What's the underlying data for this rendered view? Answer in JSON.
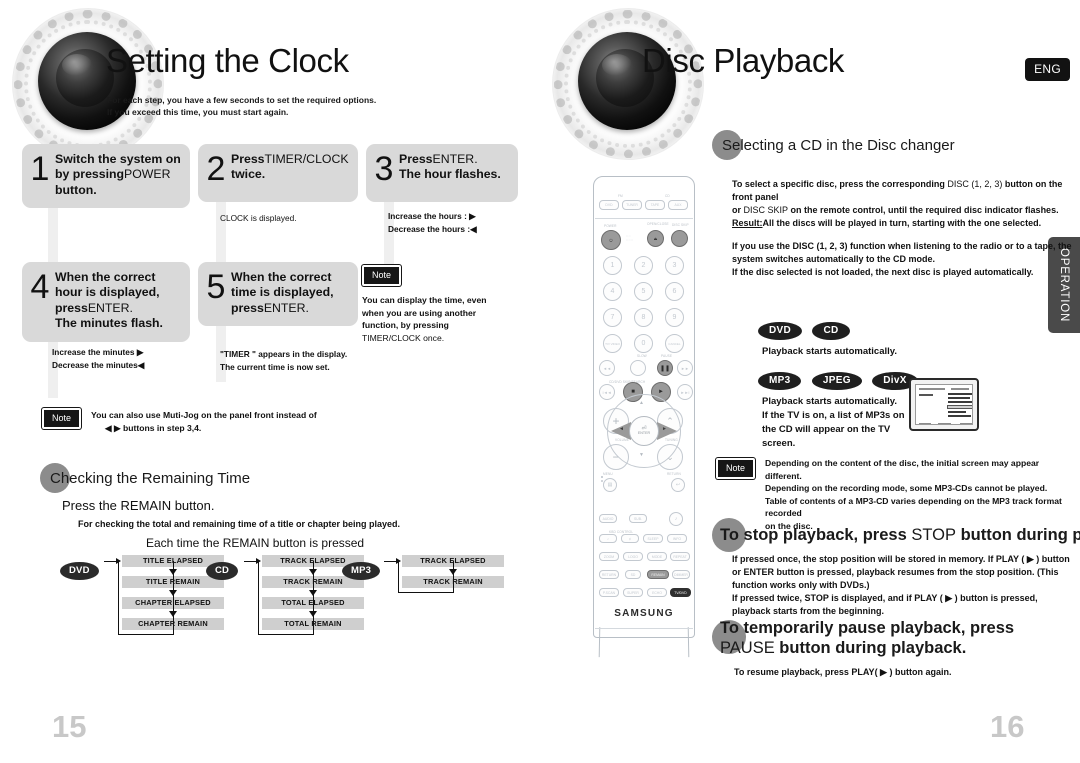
{
  "left_page": {
    "title": "Setting the Clock",
    "subtitle_lines": [
      "For each step, you have a few seconds to set the required options.",
      "If you exceed this time, you must start again."
    ],
    "steps": [
      {
        "number": "1",
        "lines": [
          {
            "bold": "Switch the system on",
            "plain": ""
          },
          {
            "bold": "by pressing",
            "plain": "POWER"
          },
          {
            "bold": "button.",
            "plain": ""
          }
        ],
        "body": []
      },
      {
        "number": "2",
        "lines": [
          {
            "bold": "Press",
            "plain": "TIMER/CLOCK"
          },
          {
            "bold": "twice.",
            "plain": ""
          }
        ],
        "body": [
          "CLOCK is displayed."
        ]
      },
      {
        "number": "3",
        "lines": [
          {
            "bold": "Press",
            "plain": "ENTER."
          },
          {
            "bold": "The hour flashes.",
            "plain": ""
          }
        ],
        "body": [
          "Increase the hours : ▶",
          "Decrease the hours :◀"
        ]
      },
      {
        "number": "4",
        "lines": [
          {
            "bold": "When the correct",
            "plain": ""
          },
          {
            "bold": "hour is displayed,",
            "plain": ""
          },
          {
            "bold": "press",
            "plain": "ENTER."
          },
          {
            "bold": "The minutes flash.",
            "plain": ""
          }
        ],
        "body": [
          "Increase the minutes ▶",
          "Decrease the minutes◀"
        ]
      },
      {
        "number": "5",
        "lines": [
          {
            "bold": "When the correct",
            "plain": ""
          },
          {
            "bold": "time is displayed,",
            "plain": ""
          },
          {
            "bold": "press",
            "plain": "ENTER."
          }
        ],
        "body": [
          "\"TIMER \" appears in the display.",
          "The current time is now set."
        ]
      }
    ],
    "note_side": {
      "label": "Note",
      "lines": [
        "You can display the time, even",
        "when you are using another",
        "function, by pressing",
        "TIMER/CLOCK once."
      ]
    },
    "note_bottom": {
      "label": "Note",
      "lines": [
        "You can also  use Muti-Jog on the panel front instead of",
        "◀ ▶ buttons in step 3,4."
      ]
    },
    "remaining": {
      "heading": "Checking the Remaining Time",
      "press_line": "Press the REMAIN button.",
      "desc": "For checking the total and remaining time of a title or chapter being played.",
      "each_time": "Each time the REMAIN button is pressed"
    },
    "page_number": "15"
  },
  "flow_chart": [
    {
      "badge": "DVD",
      "cells": [
        "TITLE ELAPSED",
        "TITLE REMAIN",
        "CHAPTER ELAPSED",
        "CHAPTER REMAIN"
      ]
    },
    {
      "badge": "CD",
      "cells": [
        "TRACK ELAPSED",
        "TRACK REMAIN",
        "TOTAL ELAPSED",
        "TOTAL REMAIN"
      ]
    },
    {
      "badge": "MP3",
      "cells": [
        "TRACK ELAPSED",
        "TRACK REMAIN"
      ]
    }
  ],
  "right_page": {
    "title": "Disc Playback",
    "eng_badge": "ENG",
    "side_tab": "OPERATION",
    "section1": {
      "heading": "Selecting a CD in the Disc changer",
      "para1": [
        {
          "b": "To select a specific disc, press the corresponding ",
          "p": "DISC (1, 2, 3)",
          "b2": " button on the front panel"
        },
        {
          "b": "or ",
          "p": "DISC SKIP",
          "b2": " on the remote control, until the required disc indicator flashes."
        }
      ],
      "result_label": "Result:",
      "result_text": "All the discs will be played in turn, starting with the one selected.",
      "para2": [
        "If you use the DISC (1, 2, 3) function when listening to the radio or to a tape, the",
        "system switches automatically to the CD mode.",
        "If the disc selected is not loaded, the next disc is played automatically."
      ],
      "group1_badges": [
        "DVD",
        "CD"
      ],
      "group1_text": [
        "Playback starts automatically."
      ],
      "group2_badges": [
        "MP3",
        "JPEG",
        "DivX"
      ],
      "group2_text": [
        "Playback starts automatically.",
        "If the TV is on, a list of MP3s on",
        "the CD will appear on the TV",
        "screen."
      ],
      "note": {
        "label": "Note",
        "lines": [
          "Depending on the content of the disc, the initial screen may appear different.",
          "Depending on the recording mode, some MP3-CDs cannot be played.",
          "Table of contents of a MP3-CD varies depending on the MP3 track format recorded",
          "on the disc."
        ]
      }
    },
    "section2": {
      "heading_bold_a": "To",
      "heading_bold_b": " stop playback, press ",
      "heading_plain": "STOP",
      "heading_bold_c": " button during playback.",
      "lines": [
        "If pressed once,  the stop position will be stored in memory. If PLAY ( ▶ ) button",
        "or ENTER button is pressed, playback resumes from the stop position. (This",
        "function works only with DVDs.)",
        "If pressed twice, STOP  is displayed, and if PLAY ( ▶ ) button is pressed,",
        "playback starts from the beginning."
      ]
    },
    "section3": {
      "heading_line1_bold": "To temporarily pause playback, press ",
      "heading_line1_plain": "PAUSE",
      "heading_line1_bold2": " button",
      "heading_line2": "during playback.",
      "sub": "To resume playback, press PLAY( ▶ ) button again."
    },
    "page_number": "16"
  },
  "remote": {
    "brand": "SAMSUNG",
    "top_row": [
      "DVD",
      "TUNER",
      "TAPE",
      "AUX"
    ],
    "top_row_labels": [
      "FM",
      "CD"
    ],
    "row2_labels": [
      "POWER",
      "OPEN/CLOSE",
      "DISC SKIP"
    ],
    "numbers": [
      "1",
      "2",
      "3",
      "4",
      "5",
      "6",
      "7",
      "8",
      "9",
      "0"
    ],
    "num_extra": [
      "TV/ VIDEO",
      "CANCEL"
    ],
    "transport_labels": [
      "PAUSE",
      "SLOW",
      "STOP",
      "PLAY"
    ],
    "enter_label": "ENTER",
    "bottom_keys": [
      "ZOOM",
      "LOGO",
      "MODE",
      "REPEAT",
      "RETURN",
      "SD",
      "REMAIN",
      "DIMMER",
      "P.SCAN",
      "SUPER",
      "ECHO",
      "TV/DVD"
    ],
    "volume_label": "VOLUME",
    "tuning_label": "TUNING",
    "menu_label": "MENU",
    "return_label": "RETURN"
  },
  "colors": {
    "step_head_bg": "#d9d9d9",
    "step_body_bg": "#efefef",
    "ball": "#8c8c8c",
    "badge_dark": "#1f1f1f",
    "tab_gray": "#4a4a4a",
    "flow_cell": "#cfcfcf",
    "page_number": "#c8c8c8"
  }
}
